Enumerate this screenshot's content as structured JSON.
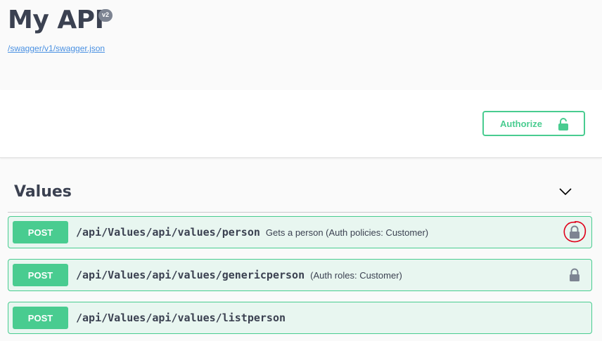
{
  "info": {
    "title": "My API",
    "version": "v2",
    "spec_link": "/swagger/v1/swagger.json"
  },
  "auth": {
    "authorize_label": "Authorize",
    "icon": "unlocked-padlock-icon",
    "accent_color": "#49cc90"
  },
  "section": {
    "title": "Values",
    "expanded": true
  },
  "operations": [
    {
      "method": "POST",
      "path": "/api/Values/api/values/person",
      "summary": "Gets a person (Auth policies: Customer)",
      "locked": true,
      "annotated_with_red_circle": true
    },
    {
      "method": "POST",
      "path": "/api/Values/api/values/genericperson",
      "summary": "(Auth roles: Customer)",
      "locked": true,
      "annotated_with_red_circle": false
    },
    {
      "method": "POST",
      "path": "/api/Values/api/values/listperson",
      "summary": "",
      "locked": false,
      "annotated_with_red_circle": false
    }
  ],
  "colors": {
    "post_method": "#49cc90",
    "post_background": "#e8f6f0",
    "lock_gray": "#7d8492",
    "annotation_red": "#e0001a"
  }
}
